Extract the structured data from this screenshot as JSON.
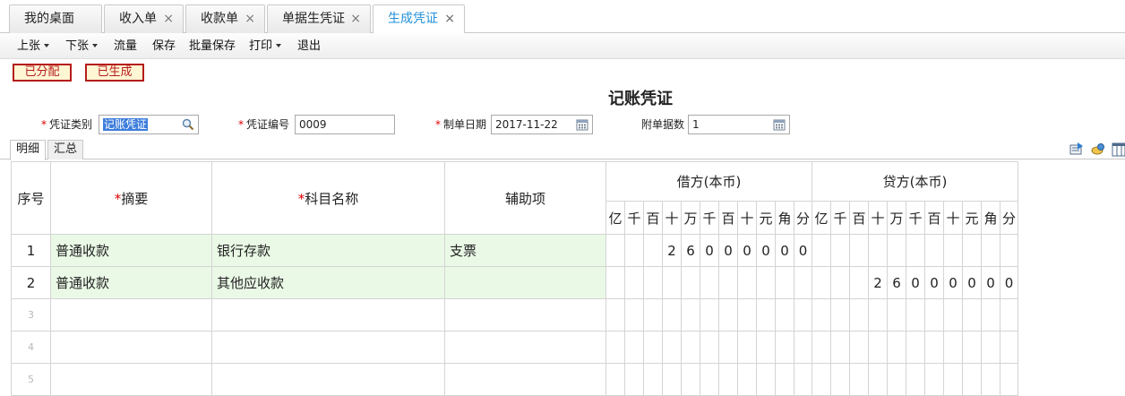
{
  "tabs": [
    {
      "label": "我的桌面",
      "closable": false
    },
    {
      "label": "收入单",
      "closable": true
    },
    {
      "label": "收款单",
      "closable": true
    },
    {
      "label": "单据生凭证",
      "closable": true
    },
    {
      "label": "生成凭证",
      "closable": true,
      "active": true
    }
  ],
  "tab_close_glyph": "×",
  "toolbar": {
    "prev": "上张",
    "next": "下张",
    "flow": "流量",
    "save": "保存",
    "batch_save": "批量保存",
    "print": "打印",
    "exit": "退出"
  },
  "status_tags": {
    "allocated": "已分配",
    "generated": "已生成"
  },
  "voucher": {
    "title": "记账凭证",
    "type_label": "凭证类别",
    "type_value": "记账凭证",
    "number_label": "凭证编号",
    "number_value": "0009",
    "date_label": "制单日期",
    "date_value": "2017-11-22",
    "attach_label": "附单据数",
    "attach_value": "1",
    "required_mark": "*"
  },
  "sub_tabs": {
    "detail": "明细",
    "summary": "汇总"
  },
  "grid": {
    "col_seq": "序号",
    "col_summary": "摘要",
    "col_account": "科目名称",
    "col_aux": "辅助项",
    "debit_header": "借方(本币)",
    "credit_header": "贷方(本币)",
    "digit_units": [
      "亿",
      "千",
      "百",
      "十",
      "万",
      "千",
      "百",
      "十",
      "元",
      "角",
      "分"
    ],
    "rows": [
      {
        "seq": "1",
        "summary": "普通收款",
        "account": "银行存款",
        "aux": "支票",
        "debit": [
          "",
          "",
          "",
          "2",
          "6",
          "0",
          "0",
          "0",
          "0",
          "0",
          "0"
        ],
        "credit": [
          "",
          "",
          "",
          "",
          "",
          "",
          "",
          "",
          "",
          "",
          ""
        ]
      },
      {
        "seq": "2",
        "summary": "普通收款",
        "account": "其他应收款",
        "aux": "",
        "debit": [
          "",
          "",
          "",
          "",
          "",
          "",
          "",
          "",
          "",
          "",
          ""
        ],
        "credit": [
          "",
          "",
          "",
          "2",
          "6",
          "0",
          "0",
          "0",
          "0",
          "0",
          "0"
        ]
      },
      {
        "seq": "3",
        "summary": "",
        "account": "",
        "aux": "",
        "debit": [],
        "credit": []
      },
      {
        "seq": "4",
        "summary": "",
        "account": "",
        "aux": "",
        "debit": [],
        "credit": []
      },
      {
        "seq": "5",
        "summary": "",
        "account": "",
        "aux": "",
        "debit": [],
        "credit": []
      }
    ]
  },
  "icons": {
    "search": "search-icon",
    "calendar": "calendar-icon",
    "caret": "caret-down-icon",
    "close": "close-icon",
    "export": "export-icon",
    "settings": "settings-icon",
    "columns": "columns-icon"
  },
  "colors": {
    "accent": "#1f8fd8",
    "tag_red": "#b51c1c",
    "tag_bg": "#fff6d4",
    "green_cell": "#eaf9e6"
  }
}
